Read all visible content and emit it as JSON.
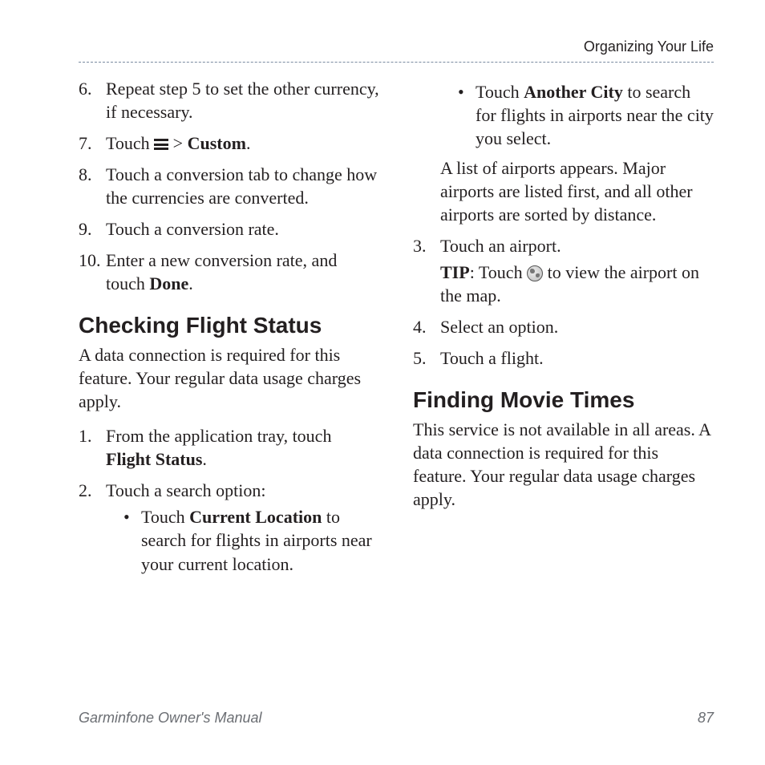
{
  "header": {
    "section": "Organizing Your Life"
  },
  "left": {
    "steps6_10": {
      "n6": "6.",
      "t6": "Repeat step 5 to set the other currency, if necessary.",
      "n7": "7.",
      "t7a": "Touch ",
      "t7b": " > ",
      "t7c": "Custom",
      "t7d": ".",
      "n8": "8.",
      "t8": "Touch a conversion tab to change how the currencies are converted.",
      "n9": "9.",
      "t9": "Touch a conversion rate.",
      "n10": "10.",
      "t10a": "Enter a new conversion rate, and touch ",
      "t10b": "Done",
      "t10c": "."
    },
    "h_flight": "Checking Flight Status",
    "p_flight": "A data connection is required for this feature. Your regular data usage charges apply.",
    "flight_steps": {
      "n1": "1.",
      "t1a": "From the application tray, touch ",
      "t1b": "Flight Status",
      "t1c": ".",
      "n2": "2.",
      "t2": "Touch a search option:",
      "b1a": "Touch ",
      "b1b": "Current Location",
      "b1c": " to search for flights in airports near your current location."
    }
  },
  "right": {
    "b2a": "Touch ",
    "b2b": "Another City",
    "b2c": " to search for flights in airports near the city you select.",
    "after_bullets": "A list of airports appears. Major airports are listed first, and all other airports are sorted by distance.",
    "n3": "3.",
    "t3": "Touch an airport.",
    "tip_label": "TIP",
    "tip_a": ": Touch ",
    "tip_b": " to view the airport on the map.",
    "n4": "4.",
    "t4": "Select an option.",
    "n5": "5.",
    "t5": "Touch a flight.",
    "h_movies": "Finding Movie Times",
    "p_movies": "This service is not available in all areas. A data connection is required for this feature. Your regular data usage charges apply."
  },
  "footer": {
    "title": "Garminfone Owner's Manual",
    "page": "87"
  }
}
